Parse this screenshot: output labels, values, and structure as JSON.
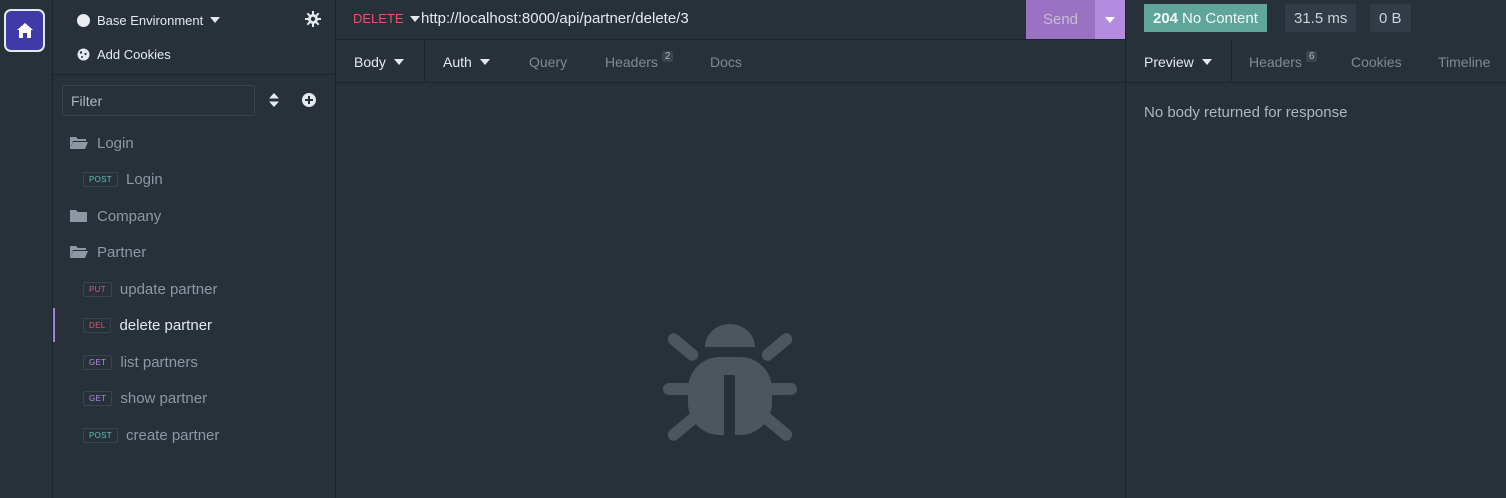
{
  "sidebar": {
    "environment_label": "Base Environment",
    "add_cookies_label": "Add Cookies",
    "filter_placeholder": "Filter",
    "items": [
      {
        "type": "folder",
        "label": "Login",
        "open": true
      },
      {
        "type": "request",
        "method": "POST",
        "label": "Login"
      },
      {
        "type": "folder",
        "label": "Company",
        "open": false
      },
      {
        "type": "folder",
        "label": "Partner",
        "open": true
      },
      {
        "type": "request",
        "method": "PUT",
        "label": "update partner"
      },
      {
        "type": "request",
        "method": "DEL",
        "label": "delete partner",
        "active": true
      },
      {
        "type": "request",
        "method": "GET",
        "label": "list partners"
      },
      {
        "type": "request",
        "method": "GET",
        "label": "show partner"
      },
      {
        "type": "request",
        "method": "POST",
        "label": "create partner"
      }
    ]
  },
  "request": {
    "method": "DELETE",
    "url": "http://localhost:8000/api/partner/delete/3",
    "send_label": "Send",
    "tabs": [
      {
        "label": "Body",
        "dropdown": true,
        "active": true
      },
      {
        "label": "Auth",
        "dropdown": true
      },
      {
        "label": "Query"
      },
      {
        "label": "Headers",
        "count": "2"
      },
      {
        "label": "Docs"
      }
    ]
  },
  "response": {
    "status_code": "204",
    "status_text": "No Content",
    "time": "31.5 ms",
    "size": "0 B",
    "tabs": [
      {
        "label": "Preview",
        "dropdown": true,
        "active": true
      },
      {
        "label": "Headers",
        "count": "6"
      },
      {
        "label": "Cookies"
      },
      {
        "label": "Timeline"
      }
    ],
    "empty_message": "No body returned for response"
  },
  "colors": {
    "POST": "#58c1b6",
    "PUT": "#e0566c",
    "DEL": "#e0566c",
    "GET": "#b48cdf",
    "accent": "#9a72c2",
    "success": "#5fa59a"
  }
}
